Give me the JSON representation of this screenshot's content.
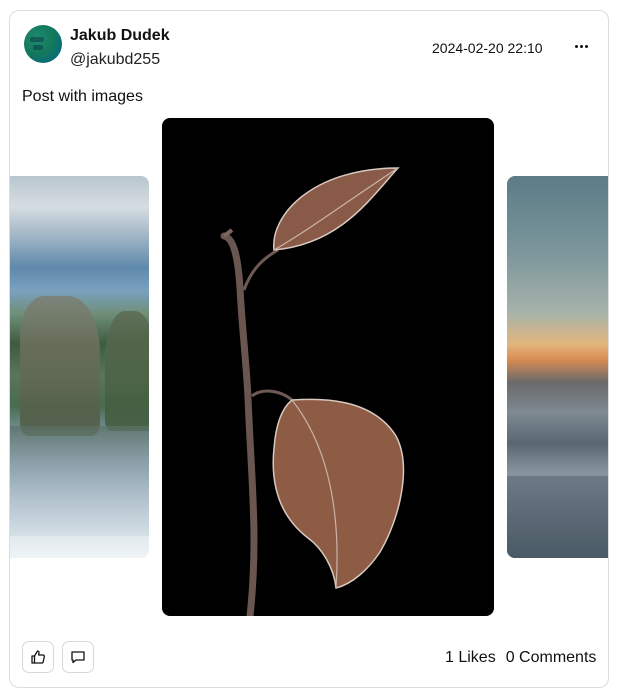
{
  "post": {
    "author_name": "Jakub Dudek",
    "author_handle": "@jakubd255",
    "timestamp": "2024-02-20 22:10",
    "text": "Post with images"
  },
  "images": [
    {
      "name": "image-left",
      "description_icon": "landscape-image"
    },
    {
      "name": "image-center",
      "description_icon": "leaf-image"
    },
    {
      "name": "image-right",
      "description_icon": "sunset-image"
    }
  ],
  "footer": {
    "likes_label": "1 Likes",
    "comments_label": "0 Comments",
    "like_icon": "thumbs-up-icon",
    "comment_icon": "comment-icon"
  },
  "colors": {
    "border": "#dcdcdc",
    "text": "#111111"
  }
}
